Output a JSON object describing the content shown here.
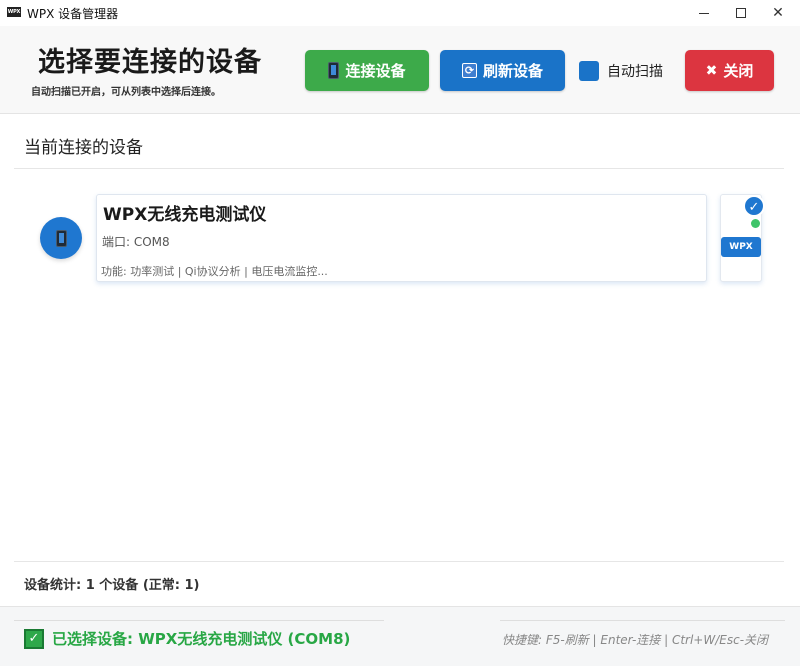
{
  "window": {
    "icon_text": "WPX",
    "title": "WPX 设备管理器",
    "min_symbol": "—",
    "close_symbol": "✕"
  },
  "header": {
    "title": "选择要连接的设备",
    "subtitle": "自动扫描已开启，可从列表中选择后连接。",
    "connect_label": "连接设备",
    "refresh_label": "刷新设备",
    "refresh_icon": "⟳",
    "auto_scan_label": "自动扫描",
    "auto_scan_checked": true,
    "close_icon": "✖",
    "close_label": "关闭"
  },
  "section": {
    "title": "当前连接的设备"
  },
  "devices": [
    {
      "name": "WPX无线充电测试仪",
      "port": "端口: COM8",
      "features": "功能: 功率测试 | Qi协议分析 | 电压电流监控...",
      "check": "✓",
      "tag": "WPX"
    }
  ],
  "stats": {
    "text": "设备统计: 1 个设备 (正常: 1)"
  },
  "footer": {
    "check": "✓",
    "selected_text": "已选择设备: WPX无线充电测试仪 (COM8)",
    "shortcuts": "快捷键: F5-刷新 | Enter-连接 | Ctrl+W/Esc-关闭"
  },
  "colors": {
    "connect": "#3daa4a",
    "refresh": "#1a73c8",
    "close": "#dc3540",
    "accent": "#1f77d0",
    "success": "#28a745"
  }
}
